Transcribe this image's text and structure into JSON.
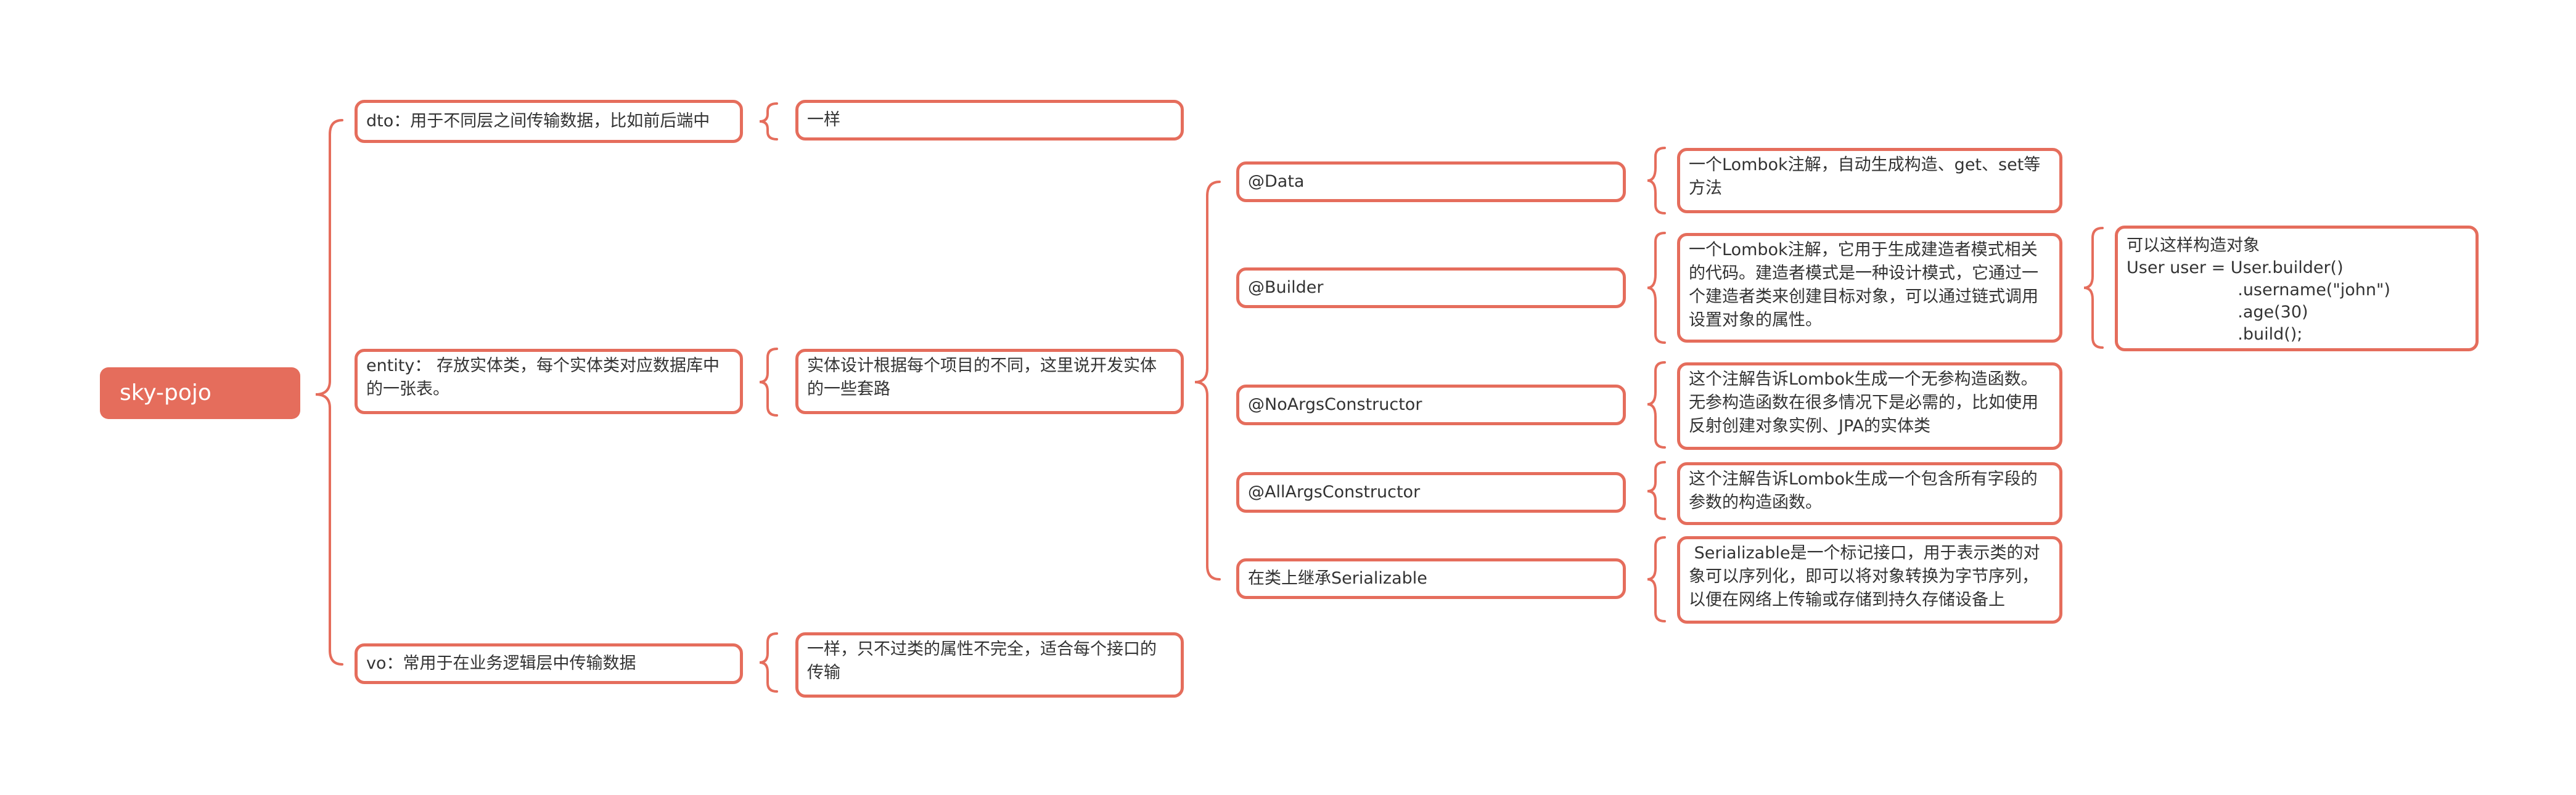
{
  "mindmap": {
    "root": "sky-pojo",
    "dto": {
      "label": "dto：用于不同层之间传输数据，比如前后端中",
      "note": "一样"
    },
    "entity": {
      "label": "entity： 存放实体类，每个实体类对应数据库中的一张表。",
      "note": "实体设计根据每个项目的不同，这里说开发实体的一些套路",
      "annotations": [
        {
          "label": "@Data",
          "desc": "一个Lombok注解，自动生成构造、get、set等方法"
        },
        {
          "label": "@Builder",
          "desc": "一个Lombok注解，它用于生成建造者模式相关的代码。建造者模式是一种设计模式，它通过一个建造者类来创建目标对象，可以通过链式调用设置对象的属性。",
          "example": "可以这样构造对象\nUser user = User.builder()\n                     .username(\"john\")\n                     .age(30)\n                     .build();"
        },
        {
          "label": "@NoArgsConstructor",
          "desc": "这个注解告诉Lombok生成一个无参构造函数。无参构造函数在很多情况下是必需的，比如使用反射创建对象实例、JPA的实体类"
        },
        {
          "label": "@AllArgsConstructor",
          "desc": "这个注解告诉Lombok生成一个包含所有字段的参数的构造函数。"
        },
        {
          "label": "在类上继承Serializable",
          "desc": " Serializable是一个标记接口，用于表示类的对象可以序列化，即可以将对象转换为字节序列，以便在网络上传输或存储到持久存储设备上"
        }
      ]
    },
    "vo": {
      "label": "vo：常用于在业务逻辑层中传输数据",
      "note": "一样，只不过类的属性不完全，适合每个接口的传输"
    }
  },
  "colors": {
    "accent": "#E56D5C",
    "text": "#333333"
  }
}
